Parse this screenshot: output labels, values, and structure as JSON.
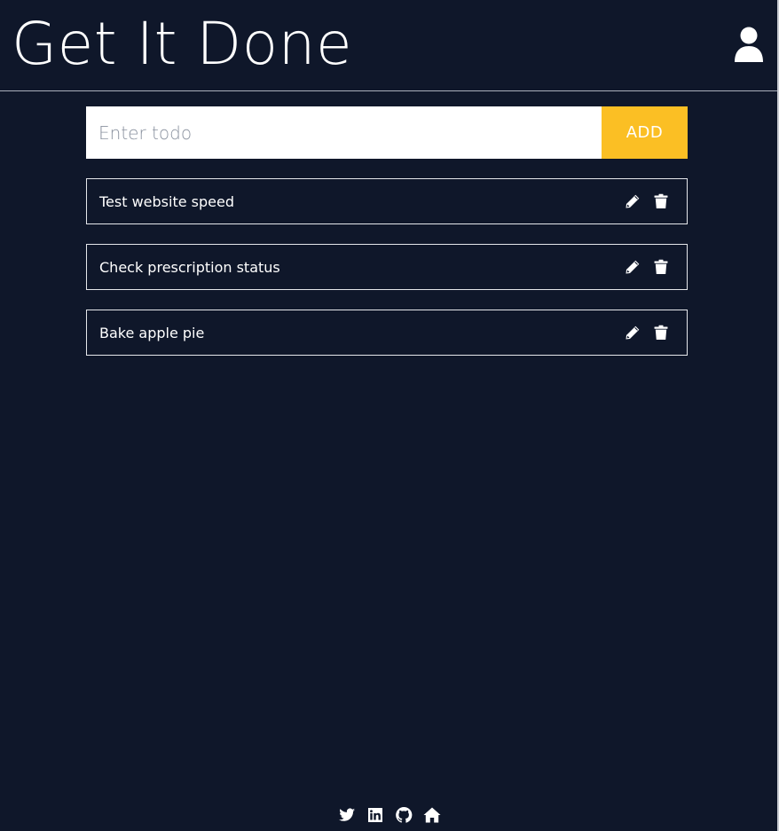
{
  "header": {
    "title": "Get It Done",
    "user_icon": "user-icon"
  },
  "form": {
    "input_value": "",
    "input_placeholder": "Enter todo",
    "add_label": "ADD",
    "add_color": "#fbbf24"
  },
  "todos": [
    {
      "text": "Test website speed",
      "edit_icon": "pencil-icon",
      "delete_icon": "trash-icon"
    },
    {
      "text": "Check prescription status",
      "edit_icon": "pencil-icon",
      "delete_icon": "trash-icon"
    },
    {
      "text": "Bake apple pie",
      "edit_icon": "pencil-icon",
      "delete_icon": "trash-icon"
    }
  ],
  "footer": {
    "links": [
      {
        "icon": "twitter-icon"
      },
      {
        "icon": "linkedin-icon"
      },
      {
        "icon": "github-icon"
      },
      {
        "icon": "home-icon"
      }
    ]
  },
  "colors": {
    "background": "#0f172a",
    "accent": "#fbbf24",
    "text": "#ffffff"
  }
}
